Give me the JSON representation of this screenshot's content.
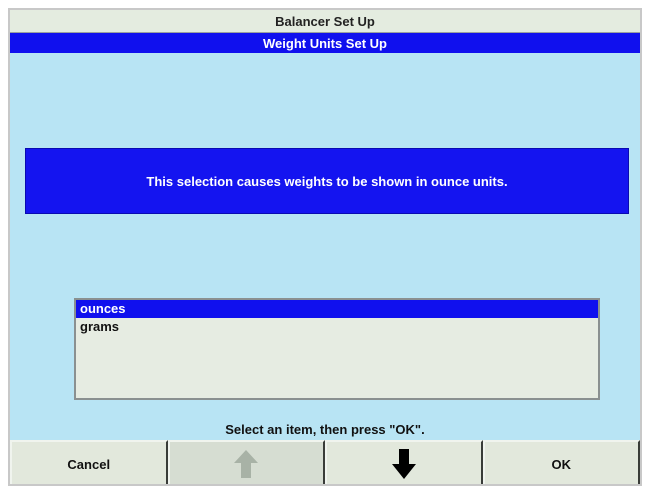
{
  "window": {
    "title": "Balancer Set Up",
    "subtitle": "Weight Units Set Up"
  },
  "message": "This selection causes weights to be shown in ounce units.",
  "list": {
    "items": [
      {
        "label": "ounces",
        "selected": true
      },
      {
        "label": "grams",
        "selected": false
      }
    ]
  },
  "instruction": "Select an item, then press \"OK\".",
  "buttons": {
    "cancel_label": "Cancel",
    "up_icon": "arrow-up-icon",
    "up_enabled": false,
    "down_icon": "arrow-down-icon",
    "down_enabled": true,
    "ok_label": "OK"
  },
  "colors": {
    "background": "#b8e4f4",
    "accent_blue": "#1010ee",
    "button_face": "#e2e8dc"
  }
}
